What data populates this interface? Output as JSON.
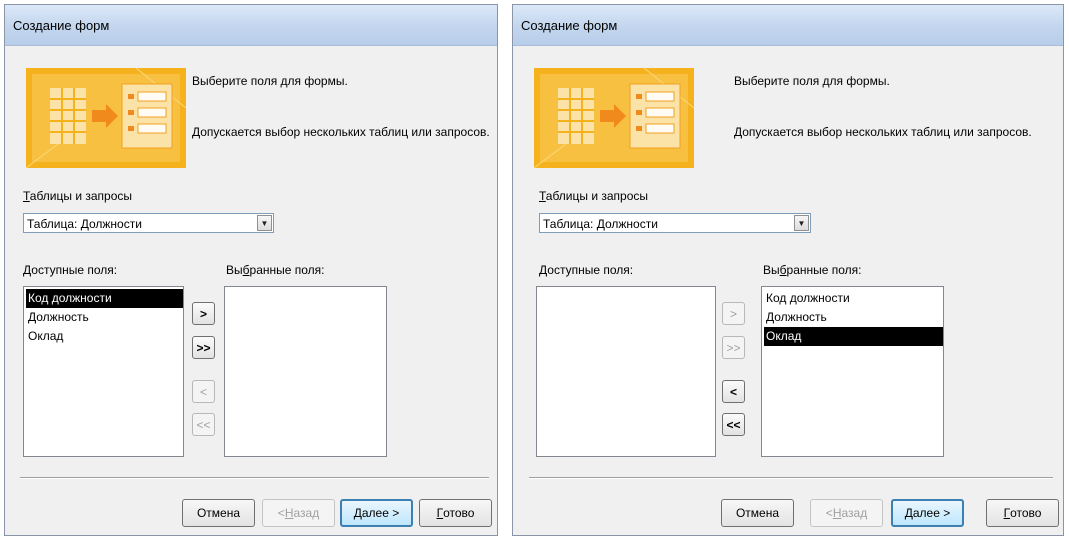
{
  "left": {
    "title": "Создание форм",
    "instruction1": "Выберите поля для формы.",
    "instruction2": "Допускается выбор нескольких таблиц или запросов.",
    "tables_label_key": "Т",
    "tables_label_rest": "аблицы и запросы",
    "combo_value": "Таблица: Должности",
    "available_label_key": "Д",
    "available_label_rest": "оступные поля:",
    "selected_label_pre": "Вы",
    "selected_label_key": "б",
    "selected_label_post": "ранные поля:",
    "available_fields": [
      "Код должности",
      "Должность",
      "Оклад"
    ],
    "available_selected_index": 0,
    "selected_fields": [],
    "move_buttons": {
      "add_one": ">",
      "add_all": ">>",
      "remove_one": "<",
      "remove_all": "<<"
    },
    "buttons": {
      "cancel": "Отмена",
      "back_prefix": "< ",
      "back_key": "Н",
      "back_rest": "азад",
      "next_key": "Д",
      "next_rest": "алее >",
      "finish_key": "Г",
      "finish_rest": "отово"
    }
  },
  "right": {
    "title": "Создание форм",
    "instruction1": "Выберите поля для формы.",
    "instruction2": "Допускается выбор нескольких таблиц или запросов.",
    "tables_label_key": "Т",
    "tables_label_rest": "аблицы и запросы",
    "combo_value": "Таблица: Должности",
    "available_label_key": "Д",
    "available_label_rest": "оступные поля:",
    "selected_label_pre": "Вы",
    "selected_label_key": "б",
    "selected_label_post": "ранные поля:",
    "available_fields": [],
    "selected_fields": [
      "Код должности",
      "Должность",
      "Оклад"
    ],
    "selected_selected_index": 2,
    "move_buttons": {
      "add_one": ">",
      "add_all": ">>",
      "remove_one": "<",
      "remove_all": "<<"
    },
    "buttons": {
      "cancel": "Отмена",
      "back_prefix": "< ",
      "back_key": "Н",
      "back_rest": "азад",
      "next_key": "Д",
      "next_rest": "алее >",
      "finish_key": "Г",
      "finish_rest": "отово"
    }
  },
  "colors": {
    "illustration_orange": "#f5b21c",
    "selection_bg": "#000000",
    "titlebar_blue": "#c3d6ee"
  },
  "icons": {
    "illustration": "table-to-form-wizard-icon",
    "dropdown": "chevron-down-icon"
  }
}
